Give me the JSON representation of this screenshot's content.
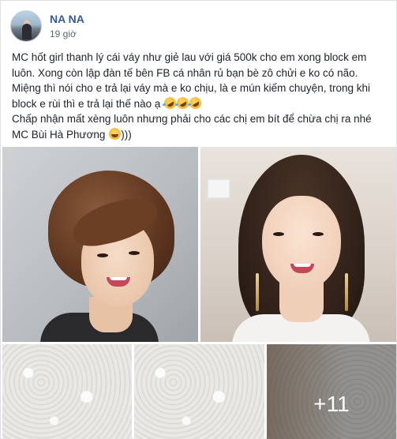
{
  "post": {
    "author_name": "NA NA",
    "timestamp": "19 giờ",
    "text_lines": [
      "MC hốt girl thanh lý cái váy như giẻ lau với giá 500k cho em xong block em luôn. Xong còn lập đàn tế bên FB cá nhân rủ bạn bè zô chửi e ko có não.",
      "Miệng thì nói cho e trả lại váy mà e ko chịu, là e mún kiếm chuyện, trong khi block e rùi thì e trả lại thế nào ạ",
      "Chấp nhận mất xèng luôn nhưng phải cho các chị em bít để chừa chị ra nhé",
      "MC Bùi Hà Phương"
    ],
    "line4_suffix": ")))"
  },
  "photos": {
    "more_count_label": "+11"
  },
  "icons": {
    "rofl": "rolling-on-floor-laughing-emoji",
    "smile": "smiling-face-emoji"
  }
}
